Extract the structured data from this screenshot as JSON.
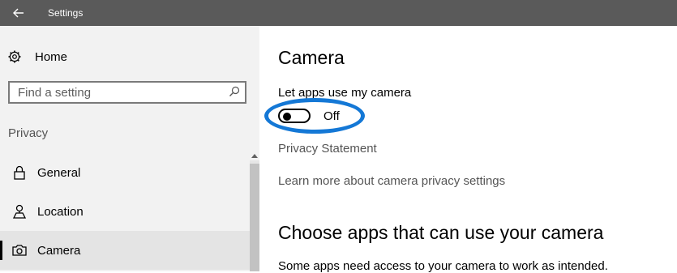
{
  "titlebar": {
    "title": "Settings"
  },
  "sidebar": {
    "home_label": "Home",
    "search_placeholder": "Find a setting",
    "section_label": "Privacy",
    "items": [
      {
        "label": "General",
        "icon": "lock-icon",
        "selected": false
      },
      {
        "label": "Location",
        "icon": "location-icon",
        "selected": false
      },
      {
        "label": "Camera",
        "icon": "camera-icon",
        "selected": true
      }
    ]
  },
  "main": {
    "title": "Camera",
    "toggle_label": "Let apps use my camera",
    "toggle_state": "Off",
    "privacy_link": "Privacy Statement",
    "learn_link": "Learn more about camera privacy settings",
    "section_heading": "Choose apps that can use your camera",
    "description": "Some apps need access to your camera to work as intended."
  },
  "colors": {
    "titlebar": "#5a5a5a",
    "sidebar": "#f2f2f2",
    "highlight": "#1478d6"
  }
}
